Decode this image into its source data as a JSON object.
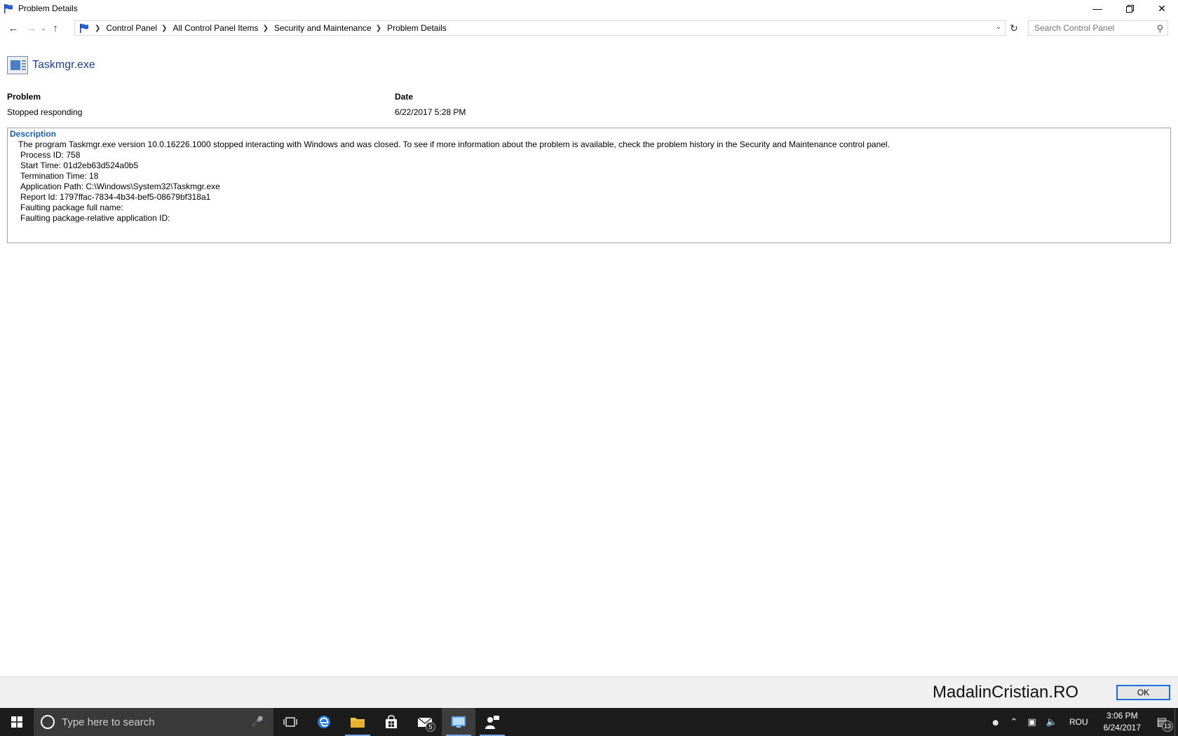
{
  "window": {
    "title": "Problem Details"
  },
  "breadcrumb": [
    "Control Panel",
    "All Control Panel Items",
    "Security and Maintenance",
    "Problem Details"
  ],
  "search": {
    "placeholder": "Search Control Panel"
  },
  "app": {
    "name": "Taskmgr.exe"
  },
  "problem": {
    "problem_label": "Problem",
    "problem_value": "Stopped responding",
    "date_label": "Date",
    "date_value": "6/22/2017 5:28 PM"
  },
  "description": {
    "title": "Description",
    "summary": "The program Taskmgr.exe version 10.0.16226.1000 stopped interacting with Windows and was closed. To see if more information about the problem is available, check the problem history in the Security and Maintenance control panel.",
    "details": [
      "Process ID: 758",
      "Start Time: 01d2eb63d524a0b5",
      "Termination Time: 18",
      "Application Path: C:\\Windows\\System32\\Taskmgr.exe",
      "Report Id: 1797ffac-7834-4b34-bef5-08679bf318a1",
      "Faulting package full name:",
      "Faulting package-relative application ID:"
    ]
  },
  "footer": {
    "watermark": "MadalinCristian.RO",
    "ok_label": "OK"
  },
  "taskbar": {
    "search_placeholder": "Type here to search",
    "mail_badge": "5",
    "language": "ROU",
    "time": "3:06 PM",
    "date": "6/24/2017",
    "notification_count": "13"
  },
  "colors": {
    "accent": "#1d6fd6",
    "link": "#1e3f8f",
    "description_title": "#1a5fb4",
    "taskbar": "#1c1c1c"
  }
}
